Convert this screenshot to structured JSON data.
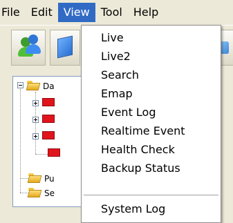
{
  "menubar": {
    "items": [
      {
        "label": "File"
      },
      {
        "label": "Edit"
      },
      {
        "label": "View"
      },
      {
        "label": "Tool"
      },
      {
        "label": "Help"
      }
    ],
    "active_index": 2
  },
  "view_menu": {
    "items": [
      {
        "label": "Live"
      },
      {
        "label": "Live2"
      },
      {
        "label": "Search"
      },
      {
        "label": "Emap"
      },
      {
        "label": "Event Log"
      },
      {
        "label": "Realtime Event"
      },
      {
        "label": "Health Check"
      },
      {
        "label": "Backup Status"
      }
    ],
    "footer_items": [
      {
        "label": "System Log"
      }
    ]
  },
  "tree": {
    "root_label": "Da",
    "child_labels": [
      "Pu",
      "Se"
    ]
  },
  "icons": {
    "toolbar": [
      "users-icon",
      "device-icon",
      "partial-icon"
    ],
    "tree": [
      "folder-icon",
      "camera-icon",
      "expand-icon",
      "collapse-icon"
    ]
  },
  "colors": {
    "highlight": "#316ac5",
    "camera_red": "#e0141c",
    "folder_yellow": "#f5c842"
  }
}
